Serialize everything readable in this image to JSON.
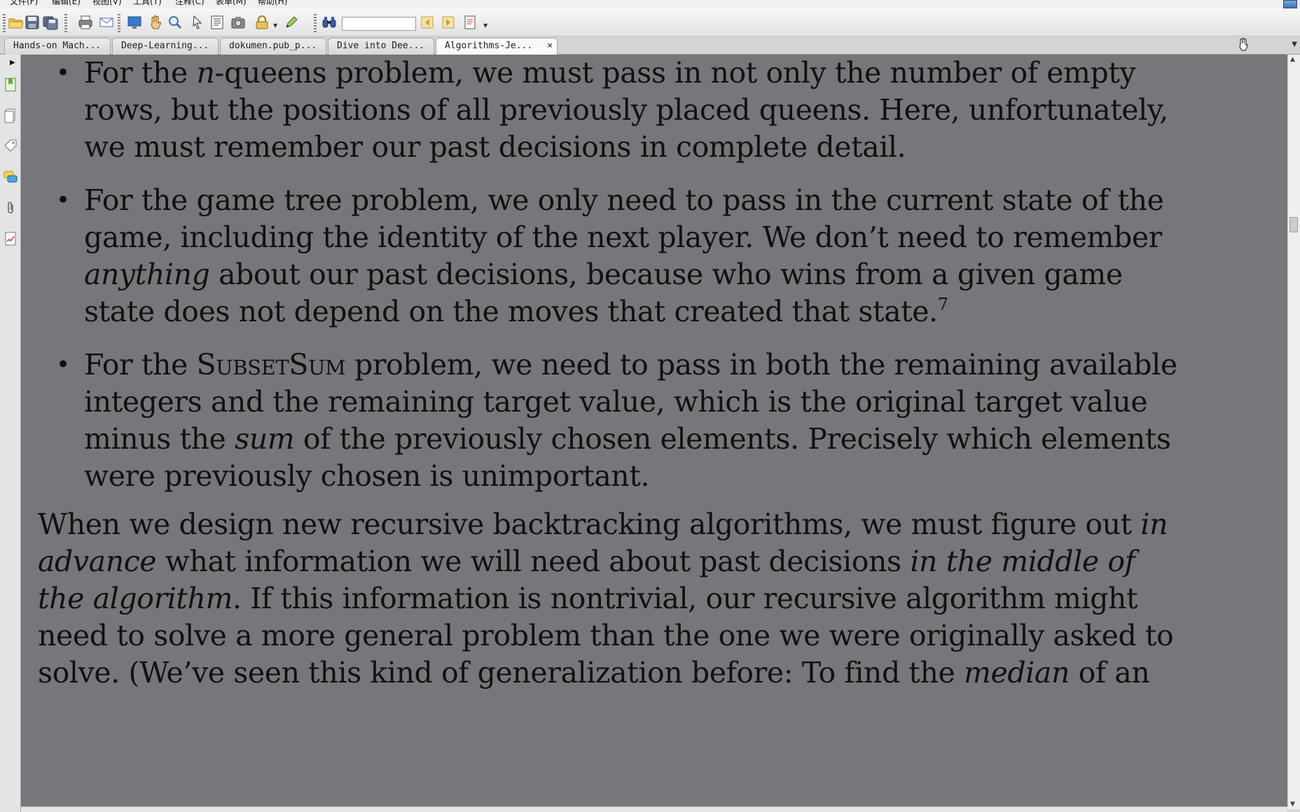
{
  "menu": {
    "items": [
      "文件(F)",
      "编辑(E)",
      "视图(V)",
      "工具(T)",
      "注释(C)",
      "表单(M)",
      "帮助(H)"
    ]
  },
  "toolbar": {
    "search_value": "",
    "icons": [
      "open-icon",
      "save-icon",
      "save-all-icon",
      "print-icon",
      "email-icon",
      "fullscreen-icon",
      "hand-icon",
      "zoom-icon",
      "select-icon",
      "snapshot-icon",
      "text-select-icon",
      "lock-icon",
      "edit-icon",
      "find-icon",
      "prev-result-icon",
      "next-result-icon",
      "doc-options-icon"
    ]
  },
  "tabs": [
    {
      "label": "Hands-on Mach...",
      "active": false
    },
    {
      "label": "Deep-Learning...",
      "active": false
    },
    {
      "label": "dokumen.pub_p...",
      "active": false
    },
    {
      "label": "Dive into Dee...",
      "active": false
    },
    {
      "label": "Algorithms-Je...",
      "active": true
    }
  ],
  "tab_close": "×",
  "tab_menu": "▼",
  "left_panel": {
    "collapse_arrow": "▶",
    "icons": [
      "bookmarks-icon",
      "pages-icon",
      "tags-icon",
      "comments-icon",
      "attachments-icon",
      "signatures-icon"
    ]
  },
  "document": {
    "bullet": "•",
    "b1": {
      "l1a": "For the ",
      "l1i": "n",
      "l1b": "-queens problem, we must pass in not only the number of empty",
      "l2": "rows, but the positions of all previously placed queens. Here, unfortunately,",
      "l3": "we must remember our past decisions in complete detail."
    },
    "b2": {
      "l1": "For the game tree problem, we only need to pass in the current state of the",
      "l2": "game, including the identity of the next player. We don’t need to remember",
      "l3i": "anything",
      "l3b": " about our past decisions, because who wins from a given game",
      "l4": "state does not depend on the moves that created that state.",
      "footnote": "7"
    },
    "b3": {
      "l1a": "For the ",
      "l1sc": "SubsetSum",
      "l1b": " problem, we need to pass in both the remaining available",
      "l2": "integers and the remaining target value, which is the original target value",
      "l3a": "minus the ",
      "l3i": "sum",
      "l3b": " of the previously chosen elements. Precisely which elements",
      "l4": "were previously chosen is unimportant."
    },
    "p": {
      "l1a": "When we design new recursive backtracking algorithms, we must figure out ",
      "l1i": "in",
      "l2i": "advance",
      "l2b": " what information we will need about past decisions ",
      "l2c": "in the middle of",
      "l3i": "the algorithm",
      "l3b": ". If this information is nontrivial, our recursive algorithm might",
      "l4": "need to solve a more general problem than the one we were originally asked to",
      "l5a": "solve. (We’ve seen this kind of generalization before: To find the ",
      "l5i": "median",
      "l5b": " of an"
    }
  },
  "scroll": {
    "up": "▲",
    "down": "▼"
  }
}
